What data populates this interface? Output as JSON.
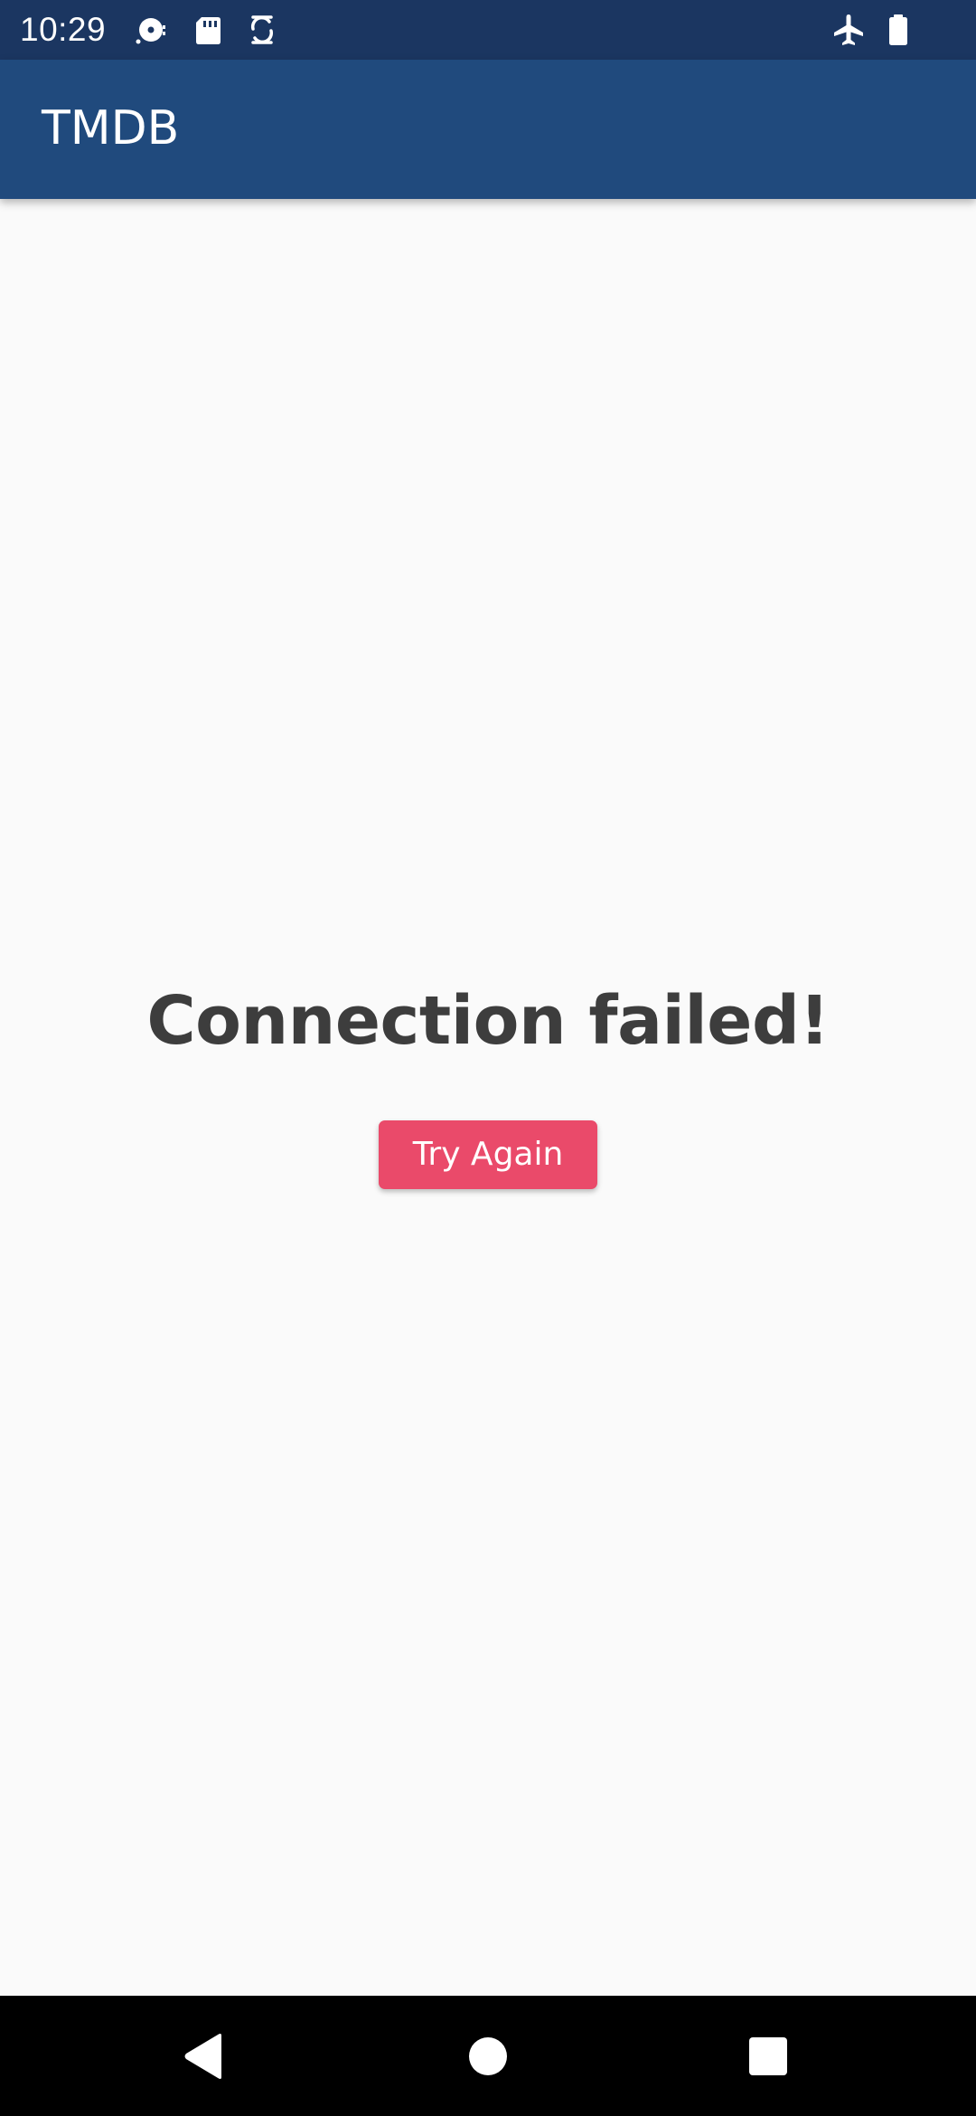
{
  "status_bar": {
    "time": "10:29",
    "icons": [
      "media-disc-icon",
      "sd-card-icon",
      "sync-icon",
      "airplane-mode-icon",
      "battery-icon"
    ]
  },
  "app_bar": {
    "title": "TMDB"
  },
  "error": {
    "message": "Connection failed!",
    "retry_label": "Try Again"
  },
  "nav_bar": {
    "buttons": [
      "back-icon",
      "home-icon",
      "recents-icon"
    ]
  },
  "colors": {
    "status_bar": "#1b3661",
    "app_bar": "#204a7d",
    "background": "#fafafa",
    "message_text": "#3d3d3d",
    "button": "#ea4a6a"
  }
}
